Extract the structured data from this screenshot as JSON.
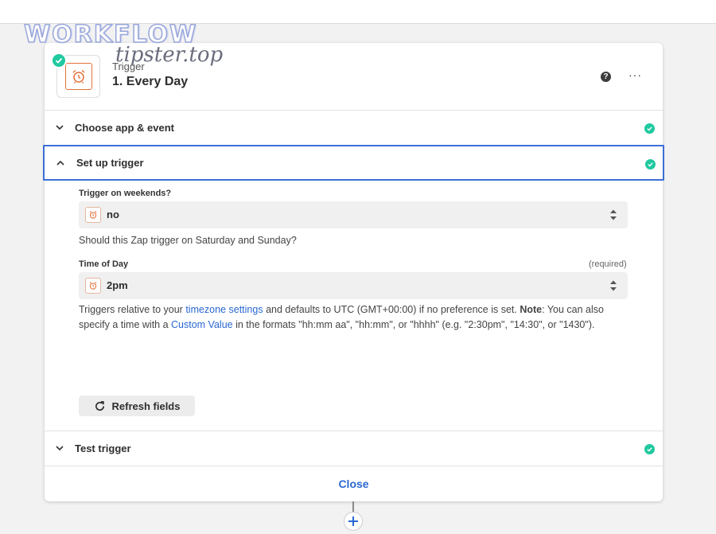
{
  "watermark": {
    "title": "WORKFLOW",
    "subtitle": "tipster.top"
  },
  "step": {
    "kind": "Trigger",
    "title": "1. Every Day",
    "icon": "alarm-clock-icon",
    "status": "complete"
  },
  "header_actions": {
    "help_icon": "question-circle-icon",
    "more_icon": "more-dots-icon"
  },
  "sections": {
    "choose": {
      "label": "Choose app & event",
      "status": "complete",
      "expanded": false
    },
    "setup": {
      "label": "Set up trigger",
      "status": "complete",
      "expanded": true
    },
    "test": {
      "label": "Test trigger",
      "status": "complete",
      "expanded": false
    }
  },
  "fields": {
    "weekends": {
      "label": "Trigger on weekends?",
      "value": "no",
      "help": "Should this Zap trigger on Saturday and Sunday?"
    },
    "time_of_day": {
      "label": "Time of Day",
      "required": "(required)",
      "value": "2pm",
      "help_part1": "Triggers relative to your ",
      "help_link1": "timezone settings",
      "help_part2": " and defaults to UTC (GMT+00:00) if no preference is set. ",
      "help_note": "Note",
      "help_part3": ": You can also specify a time with a ",
      "help_link2": "Custom Value",
      "help_part4": " in the formats \"hh:mm aa\", \"hh:mm\", or \"hhhh\" (e.g. \"2:30pm\", \"14:30\", or \"1430\")."
    }
  },
  "buttons": {
    "refresh": "Refresh fields",
    "close": "Close"
  },
  "colors": {
    "accent": "#2a68d3",
    "success": "#20c9a0",
    "icon_orange": "#e2703a",
    "focus_border": "#3d6fd6"
  }
}
